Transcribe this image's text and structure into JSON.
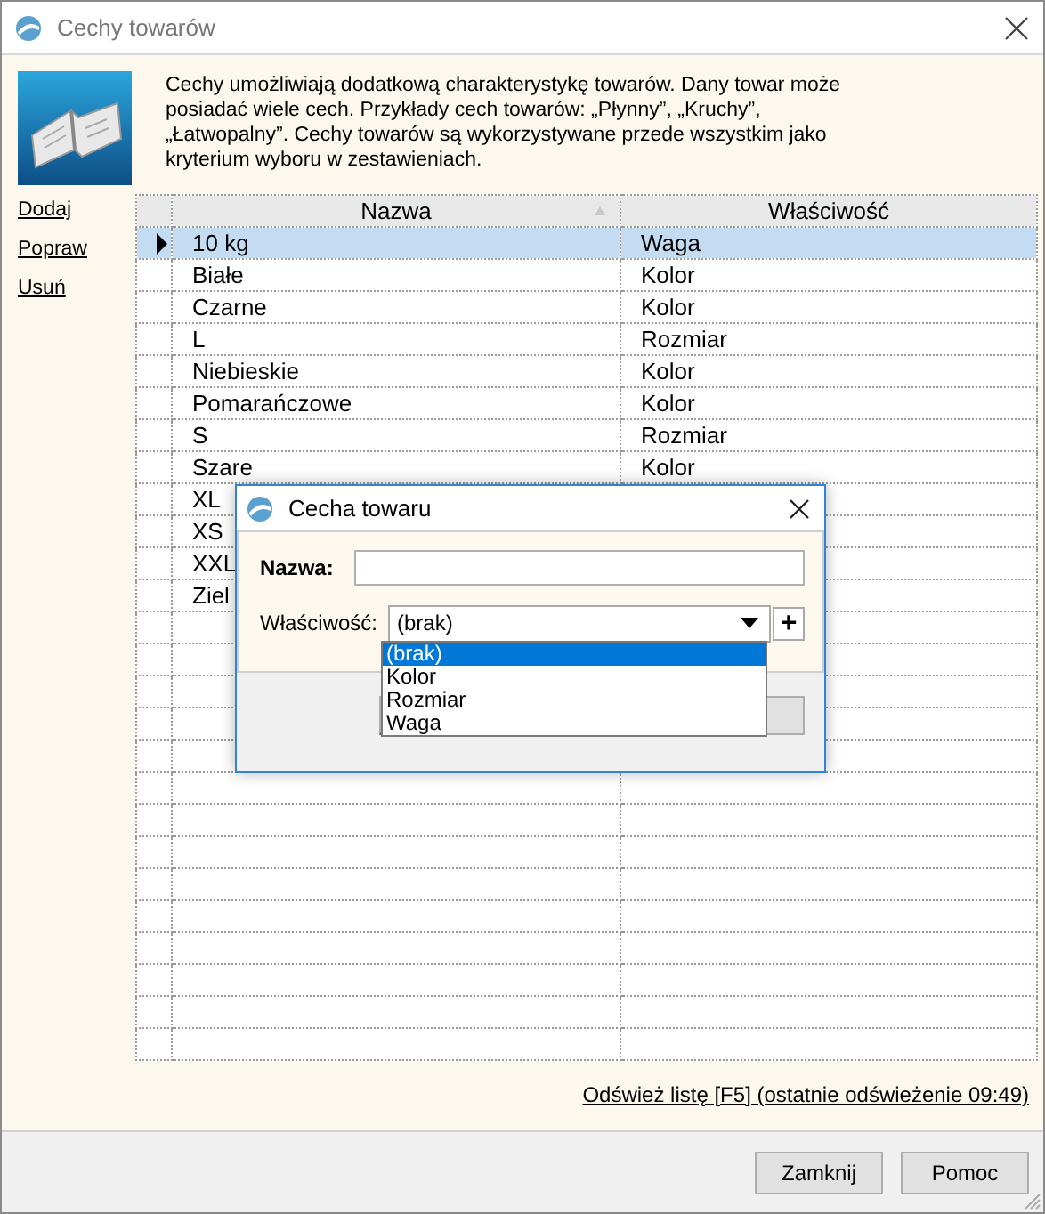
{
  "window": {
    "title": "Cechy towarów"
  },
  "description": "Cechy umożliwiają dodatkową charakterystykę towarów. Dany towar może posiadać wiele cech. Przykłady cech towarów: „Płynny”, „Kruchy”, „Łatwopalny”. Cechy towarów są wykorzystywane przede wszystkim jako kryterium wyboru w zestawieniach.",
  "actions": [
    "Dodaj",
    "Popraw",
    "Usuń"
  ],
  "table": {
    "columns": [
      {
        "label": "Nazwa",
        "sorted": true
      },
      {
        "label": "Właściwość",
        "sorted": false
      }
    ],
    "rows": [
      {
        "name": "10 kg",
        "property": "Waga",
        "selected": true
      },
      {
        "name": "Białe",
        "property": "Kolor",
        "selected": false
      },
      {
        "name": "Czarne",
        "property": "Kolor",
        "selected": false
      },
      {
        "name": "L",
        "property": "Rozmiar",
        "selected": false
      },
      {
        "name": "Niebieskie",
        "property": "Kolor",
        "selected": false
      },
      {
        "name": "Pomarańczowe",
        "property": "Kolor",
        "selected": false
      },
      {
        "name": "S",
        "property": "Rozmiar",
        "selected": false
      },
      {
        "name": "Szare",
        "property": "Kolor",
        "selected": false
      },
      {
        "name": "XL",
        "selected": false
      },
      {
        "name": "XS",
        "selected": false
      },
      {
        "name": "XXL",
        "selected": false
      },
      {
        "name": "Ziel",
        "selected": false
      }
    ]
  },
  "refresh_link": "Odśwież listę [F5] (ostatnie odświeżenie 09:49)",
  "buttons": [
    "Zamknij",
    "Pomoc"
  ],
  "dialog": {
    "title": "Cecha towaru",
    "name_label": "Nazwa:",
    "property_label": "Właściwość:",
    "property_value": "(brak)",
    "add_button": "+",
    "options": [
      {
        "label": "(brak)",
        "selected": true
      },
      {
        "label": "Kolor",
        "selected": false
      },
      {
        "label": "Rozmiar",
        "selected": false
      },
      {
        "label": "Waga",
        "selected": false
      }
    ]
  }
}
